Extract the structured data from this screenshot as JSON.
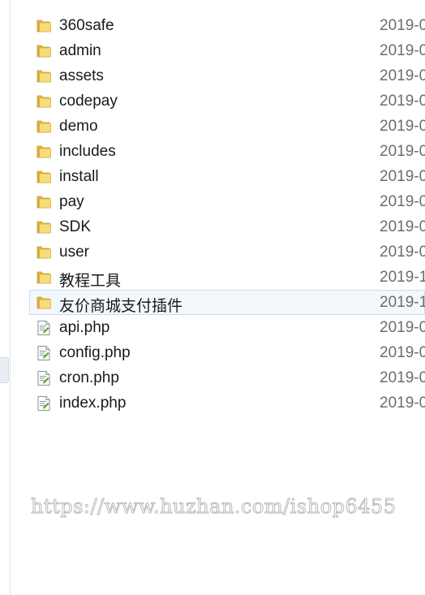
{
  "files": [
    {
      "name": "360safe",
      "type": "folder",
      "date": "2019-0"
    },
    {
      "name": "admin",
      "type": "folder",
      "date": "2019-0"
    },
    {
      "name": "assets",
      "type": "folder",
      "date": "2019-0"
    },
    {
      "name": "codepay",
      "type": "folder",
      "date": "2019-0"
    },
    {
      "name": "demo",
      "type": "folder",
      "date": "2019-0"
    },
    {
      "name": "includes",
      "type": "folder",
      "date": "2019-0"
    },
    {
      "name": "install",
      "type": "folder",
      "date": "2019-0"
    },
    {
      "name": "pay",
      "type": "folder",
      "date": "2019-0"
    },
    {
      "name": "SDK",
      "type": "folder",
      "date": "2019-0"
    },
    {
      "name": "user",
      "type": "folder",
      "date": "2019-0"
    },
    {
      "name": "教程工具",
      "type": "folder",
      "date": "2019-1"
    },
    {
      "name": "友价商城支付插件",
      "type": "folder",
      "date": "2019-1",
      "selected": true
    },
    {
      "name": "api.php",
      "type": "php-file",
      "date": "2019-0"
    },
    {
      "name": "config.php",
      "type": "php-file",
      "date": "2019-0"
    },
    {
      "name": "cron.php",
      "type": "php-file",
      "date": "2019-0"
    },
    {
      "name": "index.php",
      "type": "php-file",
      "date": "2019-0"
    }
  ],
  "icons": {
    "folder": "folder-icon",
    "php-file": "php-file-icon"
  },
  "colors": {
    "folder": "#f2cf5b",
    "selection_border": "#c7ddf2",
    "selection_fill": "#f3f8fd"
  },
  "watermark": "https://www.huzhan.com/ishop6455"
}
